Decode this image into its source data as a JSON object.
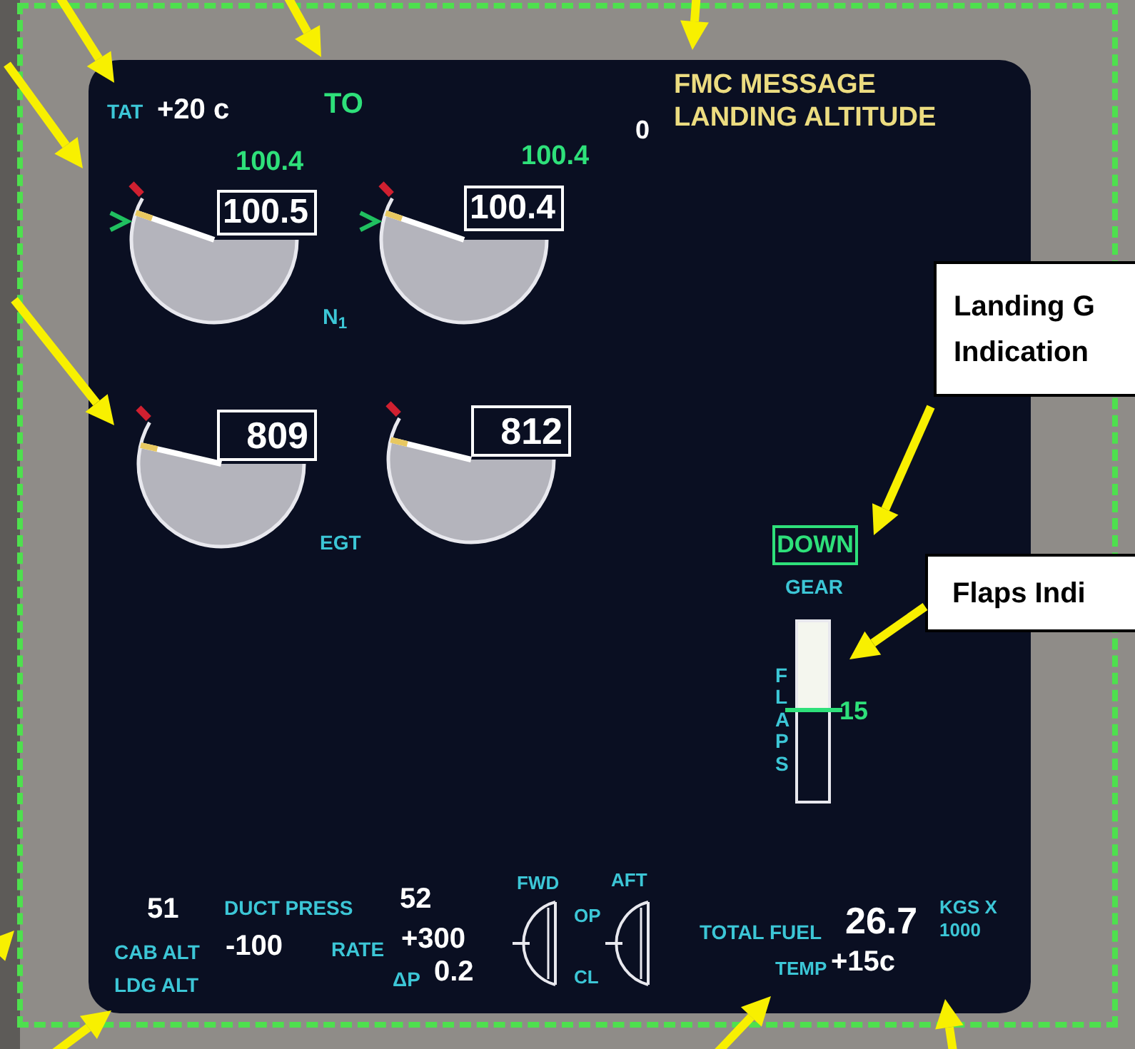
{
  "header": {
    "tat_label": "TAT",
    "tat_value": "+20 c",
    "thrust_mode": "TO",
    "message_count": "0",
    "fmc_message": [
      "FMC MESSAGE",
      "LANDING ALTITUDE"
    ]
  },
  "n1": {
    "label": "N$_{1}$",
    "gauges": [
      {
        "target": "100.4",
        "reading": "100.5"
      },
      {
        "target": "100.4",
        "reading": "100.4"
      }
    ]
  },
  "egt": {
    "label": "EGT",
    "gauges": [
      {
        "reading": "809"
      },
      {
        "reading": "812"
      }
    ]
  },
  "gear": {
    "status": "DOWN",
    "label": "GEAR"
  },
  "flaps": {
    "label": "FLAPS",
    "reading": "15",
    "level": 0.49
  },
  "pressurization": {
    "cabin_value": "51",
    "duct_press_label": "DUCT PRESS",
    "duct_value": "52",
    "cab_alt_label": "CAB ALT",
    "cab_alt_value": "-100",
    "rate_label": "RATE",
    "rate_value": "+300",
    "ldg_alt_label": "LDG ALT",
    "dp_label": "ΔP",
    "dp_value": "0.2"
  },
  "outflow_valves": {
    "fwd_label": "FWD",
    "aft_label": "AFT",
    "open_label": "OP",
    "closed_label": "CL"
  },
  "fuel": {
    "total_label": "TOTAL FUEL",
    "total_value": "26.7",
    "units": [
      "KGS X",
      "1000"
    ],
    "temp_label": "TEMP",
    "temp_value": "+15c"
  },
  "callouts": [
    {
      "lines": [
        "Landing G",
        "Indication"
      ]
    },
    {
      "lines": [
        "Flaps Indi"
      ]
    }
  ]
}
